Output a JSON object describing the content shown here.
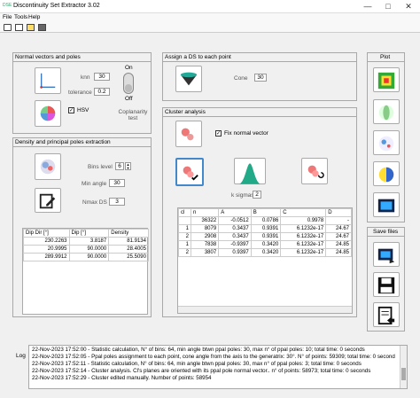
{
  "window": {
    "title": "Discontinuity Set Extractor 3.02",
    "app_icon": "DSE",
    "minimize": "—",
    "maximize": "□",
    "close": "✕"
  },
  "menu": [
    "File",
    "Tools",
    "Help"
  ],
  "toolbar": [
    "delete-icon",
    "new-file-icon",
    "open-folder-icon",
    "save-icon"
  ],
  "normals": {
    "title": "Normal vectors and poles",
    "knn_label": "knn",
    "knn_value": "30",
    "tolerance_label": "tolerance",
    "tolerance_value": "0.2",
    "on_label": "On",
    "off_label": "Off",
    "hsv_label": "HSV",
    "coplanarity_label": "Coplanarity test"
  },
  "density": {
    "title": "Density and principal poles extraction",
    "bins_label": "Bins level",
    "bins_value": "6",
    "minangle_label": "Min angle",
    "minangle_value": "30",
    "nmax_label": "Nmax DS",
    "nmax_value": "3"
  },
  "poles_table": {
    "headers": [
      "Dip Dir [°]",
      "Dip [°]",
      "Density"
    ],
    "rows": [
      [
        "230.2263",
        "3.8187",
        "81.9134"
      ],
      [
        "20.9995",
        "90.0000",
        "28.4005"
      ],
      [
        "289.9912",
        "90.0000",
        "25.5090"
      ]
    ]
  },
  "assign": {
    "title": "Assign a DS to each point",
    "cone_label": "Cone",
    "cone_value": "30"
  },
  "cluster": {
    "title": "Cluster analysis",
    "fix_label": "Fix normal vector",
    "ksigma_label": "k sigmas",
    "ksigma_value": "2",
    "headers": [
      "cl",
      "n",
      "A",
      "B",
      "C",
      "D"
    ],
    "rows": [
      [
        "",
        "36322",
        "-0.0512",
        "0.0786",
        "0.9978",
        "-"
      ],
      [
        "1",
        "8079",
        "0.3437",
        "0.9391",
        "6.1232e-17",
        "24.67"
      ],
      [
        "2",
        "2908",
        "0.3437",
        "0.9391",
        "6.1232e-17",
        "24.67"
      ],
      [
        "1",
        "7838",
        "-0.9397",
        "0.3420",
        "6.1232e-17",
        "24.85"
      ],
      [
        "2",
        "3807",
        "0.9397",
        "0.3420",
        "6.1232e-17",
        "24.85"
      ]
    ],
    "row_flags": [
      "",
      "",
      "",
      "",
      ""
    ]
  },
  "plot": {
    "title": "Plot"
  },
  "save": {
    "title": "Save files"
  },
  "log": {
    "label": "Log",
    "lines": [
      "22-Nov-2023 17:52:00 - Statistic calculation, N° of bins: 64, min angle btwn ppal poles: 30, max n° of ppal poles: 10; total time: 0 seconds",
      "22-Nov-2023 17:52:05 - Ppal poles assignment to each point, cone angle from the axis to the generatrix: 30°. N° of points: 59309; total time: 0 seconds",
      "22-Nov-2023 17:52:11 - Statistic calculation, N° of bins: 64, min angle btwn ppal poles: 30, max n° of ppal poles: 3; total time: 0 seconds",
      "22-Nov-2023 17:52:14 - Cluster analysis. Cl's planes are oriented with its ppal pole normal vector.. n° of points: 58973; total time: 0 seconds",
      "22-Nov-2023 17:52:29 - Cluster edited manually. Number of points: 58954"
    ]
  }
}
